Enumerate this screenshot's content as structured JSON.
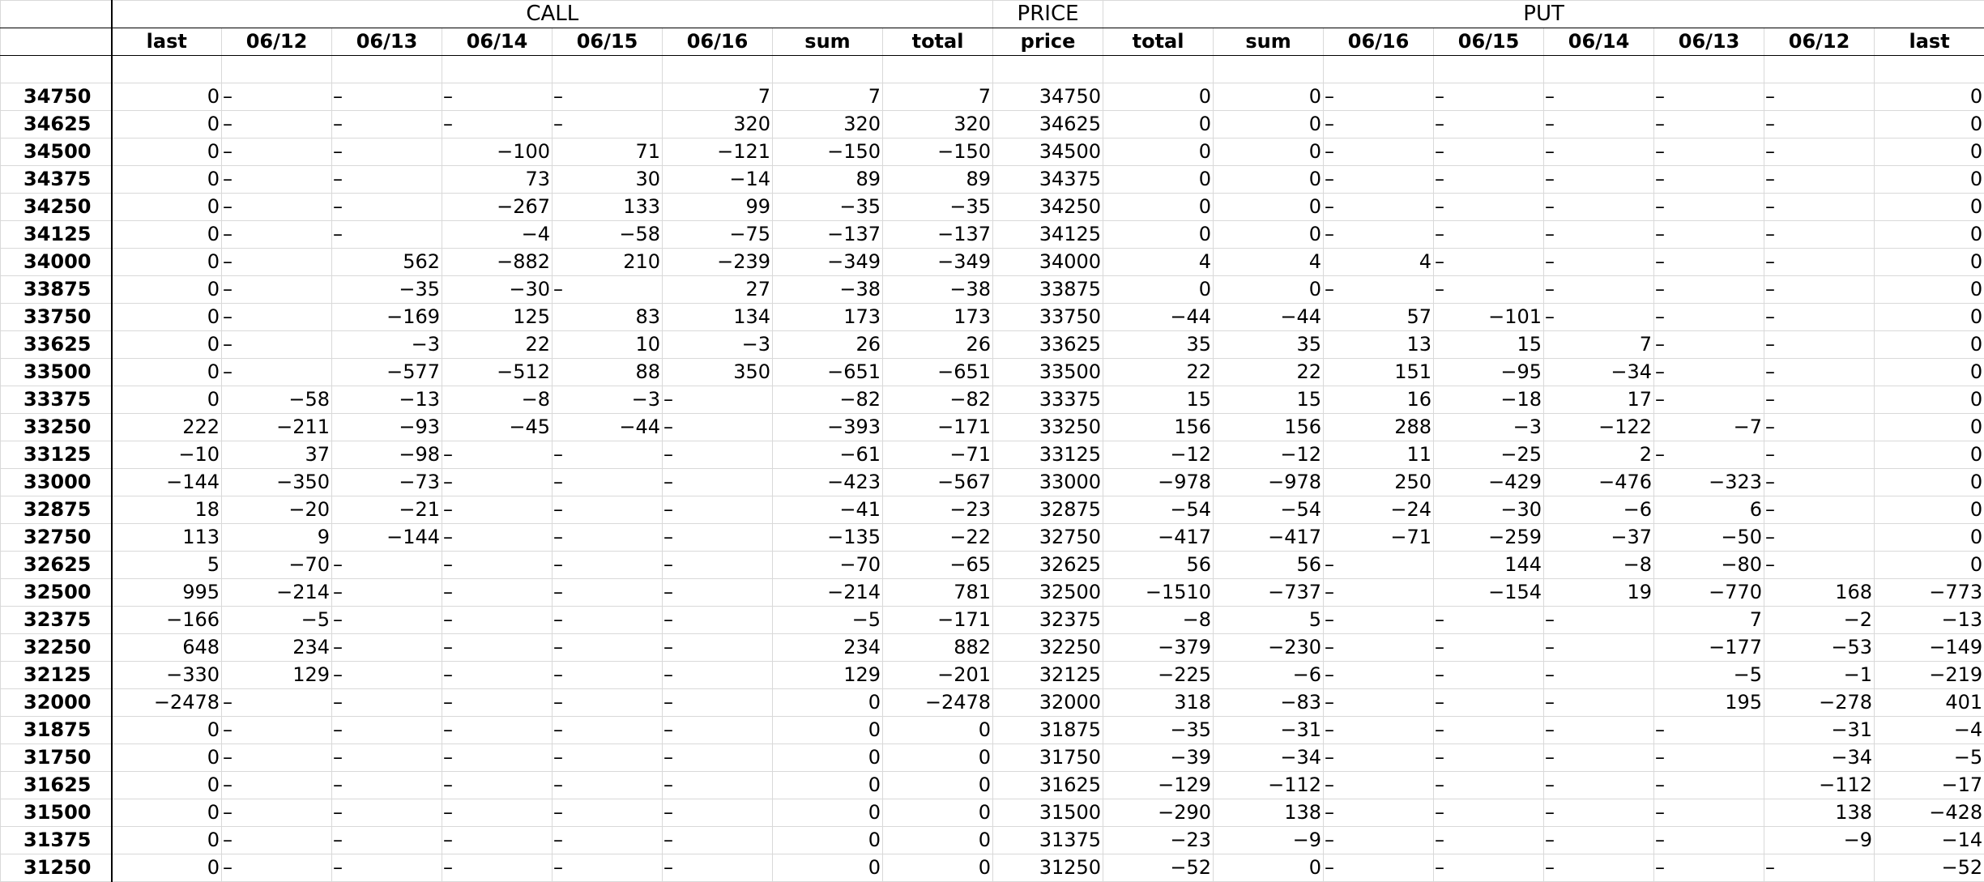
{
  "sheet": {
    "group_call": "CALL",
    "group_price": "PRICE",
    "group_put": "PUT",
    "columns": [
      "last",
      "06/12",
      "06/13",
      "06/14",
      "06/15",
      "06/16",
      "sum",
      "total",
      "price",
      "total",
      "sum",
      "06/16",
      "06/15",
      "06/14",
      "06/13",
      "06/12",
      "last"
    ],
    "rows": [
      {
        "strike": "34750",
        "cells": [
          "0",
          "–",
          "–",
          "–",
          "–",
          "7",
          "7",
          "7",
          "34750",
          "0",
          "0",
          "–",
          "–",
          "–",
          "–",
          "–",
          "0"
        ]
      },
      {
        "strike": "34625",
        "cells": [
          "0",
          "–",
          "–",
          "–",
          "–",
          "320",
          "320",
          "320",
          "34625",
          "0",
          "0",
          "–",
          "–",
          "–",
          "–",
          "–",
          "0"
        ]
      },
      {
        "strike": "34500",
        "cells": [
          "0",
          "–",
          "–",
          "−100",
          "71",
          "−121",
          "−150",
          "−150",
          "34500",
          "0",
          "0",
          "–",
          "–",
          "–",
          "–",
          "–",
          "0"
        ]
      },
      {
        "strike": "34375",
        "cells": [
          "0",
          "–",
          "–",
          "73",
          "30",
          "−14",
          "89",
          "89",
          "34375",
          "0",
          "0",
          "–",
          "–",
          "–",
          "–",
          "–",
          "0"
        ]
      },
      {
        "strike": "34250",
        "cells": [
          "0",
          "–",
          "–",
          "−267",
          "133",
          "99",
          "−35",
          "−35",
          "34250",
          "0",
          "0",
          "–",
          "–",
          "–",
          "–",
          "–",
          "0"
        ]
      },
      {
        "strike": "34125",
        "cells": [
          "0",
          "–",
          "–",
          "−4",
          "−58",
          "−75",
          "−137",
          "−137",
          "34125",
          "0",
          "0",
          "–",
          "–",
          "–",
          "–",
          "–",
          "0"
        ]
      },
      {
        "strike": "34000",
        "cells": [
          "0",
          "–",
          "562",
          "−882",
          "210",
          "−239",
          "−349",
          "−349",
          "34000",
          "4",
          "4",
          "4",
          "–",
          "–",
          "–",
          "–",
          "0"
        ]
      },
      {
        "strike": "33875",
        "cells": [
          "0",
          "–",
          "−35",
          "−30",
          "–",
          "27",
          "−38",
          "−38",
          "33875",
          "0",
          "0",
          "–",
          "–",
          "–",
          "–",
          "–",
          "0"
        ]
      },
      {
        "strike": "33750",
        "cells": [
          "0",
          "–",
          "−169",
          "125",
          "83",
          "134",
          "173",
          "173",
          "33750",
          "−44",
          "−44",
          "57",
          "−101",
          "–",
          "–",
          "–",
          "0"
        ]
      },
      {
        "strike": "33625",
        "cells": [
          "0",
          "–",
          "−3",
          "22",
          "10",
          "−3",
          "26",
          "26",
          "33625",
          "35",
          "35",
          "13",
          "15",
          "7",
          "–",
          "–",
          "0"
        ]
      },
      {
        "strike": "33500",
        "cells": [
          "0",
          "–",
          "−577",
          "−512",
          "88",
          "350",
          "−651",
          "−651",
          "33500",
          "22",
          "22",
          "151",
          "−95",
          "−34",
          "–",
          "–",
          "0"
        ]
      },
      {
        "strike": "33375",
        "cells": [
          "0",
          "−58",
          "−13",
          "−8",
          "−3",
          "–",
          "−82",
          "−82",
          "33375",
          "15",
          "15",
          "16",
          "−18",
          "17",
          "–",
          "–",
          "0"
        ]
      },
      {
        "strike": "33250",
        "cells": [
          "222",
          "−211",
          "−93",
          "−45",
          "−44",
          "–",
          "−393",
          "−171",
          "33250",
          "156",
          "156",
          "288",
          "−3",
          "−122",
          "−7",
          "–",
          "0"
        ]
      },
      {
        "strike": "33125",
        "cells": [
          "−10",
          "37",
          "−98",
          "–",
          "–",
          "–",
          "−61",
          "−71",
          "33125",
          "−12",
          "−12",
          "11",
          "−25",
          "2",
          "–",
          "–",
          "0"
        ]
      },
      {
        "strike": "33000",
        "cells": [
          "−144",
          "−350",
          "−73",
          "–",
          "–",
          "–",
          "−423",
          "−567",
          "33000",
          "−978",
          "−978",
          "250",
          "−429",
          "−476",
          "−323",
          "–",
          "0"
        ]
      },
      {
        "strike": "32875",
        "cells": [
          "18",
          "−20",
          "−21",
          "–",
          "–",
          "–",
          "−41",
          "−23",
          "32875",
          "−54",
          "−54",
          "−24",
          "−30",
          "−6",
          "6",
          "–",
          "0"
        ]
      },
      {
        "strike": "32750",
        "cells": [
          "113",
          "9",
          "−144",
          "–",
          "–",
          "–",
          "−135",
          "−22",
          "32750",
          "−417",
          "−417",
          "−71",
          "−259",
          "−37",
          "−50",
          "–",
          "0"
        ]
      },
      {
        "strike": "32625",
        "cells": [
          "5",
          "−70",
          "–",
          "–",
          "–",
          "–",
          "−70",
          "−65",
          "32625",
          "56",
          "56",
          "–",
          "144",
          "−8",
          "−80",
          "–",
          "0"
        ]
      },
      {
        "strike": "32500",
        "cells": [
          "995",
          "−214",
          "–",
          "–",
          "–",
          "–",
          "−214",
          "781",
          "32500",
          "−1510",
          "−737",
          "–",
          "−154",
          "19",
          "−770",
          "168",
          "−773"
        ]
      },
      {
        "strike": "32375",
        "cells": [
          "−166",
          "−5",
          "–",
          "–",
          "–",
          "–",
          "−5",
          "−171",
          "32375",
          "−8",
          "5",
          "–",
          "–",
          "–",
          "7",
          "−2",
          "−13"
        ]
      },
      {
        "strike": "32250",
        "cells": [
          "648",
          "234",
          "–",
          "–",
          "–",
          "–",
          "234",
          "882",
          "32250",
          "−379",
          "−230",
          "–",
          "–",
          "–",
          "−177",
          "−53",
          "−149"
        ]
      },
      {
        "strike": "32125",
        "cells": [
          "−330",
          "129",
          "–",
          "–",
          "–",
          "–",
          "129",
          "−201",
          "32125",
          "−225",
          "−6",
          "–",
          "–",
          "–",
          "−5",
          "−1",
          "−219"
        ]
      },
      {
        "strike": "32000",
        "cells": [
          "−2478",
          "–",
          "–",
          "–",
          "–",
          "–",
          "0",
          "−2478",
          "32000",
          "318",
          "−83",
          "–",
          "–",
          "–",
          "195",
          "−278",
          "401"
        ]
      },
      {
        "strike": "31875",
        "cells": [
          "0",
          "–",
          "–",
          "–",
          "–",
          "–",
          "0",
          "0",
          "31875",
          "−35",
          "−31",
          "–",
          "–",
          "–",
          "–",
          "−31",
          "−4"
        ]
      },
      {
        "strike": "31750",
        "cells": [
          "0",
          "–",
          "–",
          "–",
          "–",
          "–",
          "0",
          "0",
          "31750",
          "−39",
          "−34",
          "–",
          "–",
          "–",
          "–",
          "−34",
          "−5"
        ]
      },
      {
        "strike": "31625",
        "cells": [
          "0",
          "–",
          "–",
          "–",
          "–",
          "–",
          "0",
          "0",
          "31625",
          "−129",
          "−112",
          "–",
          "–",
          "–",
          "–",
          "−112",
          "−17"
        ]
      },
      {
        "strike": "31500",
        "cells": [
          "0",
          "–",
          "–",
          "–",
          "–",
          "–",
          "0",
          "0",
          "31500",
          "−290",
          "138",
          "–",
          "–",
          "–",
          "–",
          "138",
          "−428"
        ]
      },
      {
        "strike": "31375",
        "cells": [
          "0",
          "–",
          "–",
          "–",
          "–",
          "–",
          "0",
          "0",
          "31375",
          "−23",
          "−9",
          "–",
          "–",
          "–",
          "–",
          "−9",
          "−14"
        ]
      },
      {
        "strike": "31250",
        "cells": [
          "0",
          "–",
          "–",
          "–",
          "–",
          "–",
          "0",
          "0",
          "31250",
          "−52",
          "0",
          "–",
          "–",
          "–",
          "–",
          "–",
          "−52"
        ]
      }
    ]
  }
}
